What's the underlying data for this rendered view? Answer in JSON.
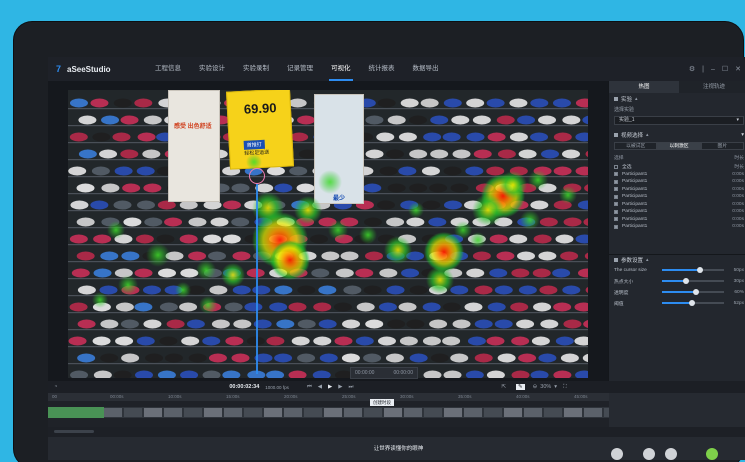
{
  "app": {
    "name": "aSeeStudio"
  },
  "nav": [
    "工程信息",
    "实验设计",
    "实验录制",
    "记录管理",
    "可视化",
    "统计报表",
    "数据导出"
  ],
  "nav_active": "可视化",
  "side": {
    "tabs": [
      "热图",
      "注视轨迹"
    ],
    "experiment_section": "实验",
    "select_label": "选择实验",
    "selected_experiment": "实验_1",
    "data_section": "视频选择",
    "segments": [
      "以被试区",
      "以刺激区",
      "图片"
    ],
    "list_header": [
      "选择",
      "时长"
    ],
    "list_group_title": "全选",
    "participants": [
      {
        "name": "全选",
        "time": "时长",
        "checked": false
      },
      {
        "name": "Participant1",
        "time": "0:00s",
        "checked": true
      },
      {
        "name": "Participant1",
        "time": "0:00s",
        "checked": true
      },
      {
        "name": "Participant1",
        "time": "0:00s",
        "checked": true
      },
      {
        "name": "Participant1",
        "time": "0:00s",
        "checked": true
      },
      {
        "name": "Participant1",
        "time": "0:00s",
        "checked": true
      },
      {
        "name": "Participant1",
        "time": "0:00s",
        "checked": true
      },
      {
        "name": "Participant1",
        "time": "0:00s",
        "checked": true
      },
      {
        "name": "Participant1",
        "time": "0:00s",
        "checked": true
      }
    ],
    "params_section": "参数设置",
    "params": [
      {
        "label": "The cursor size",
        "value": "50px",
        "level": 0.62
      },
      {
        "label": "热点大小",
        "value": "30px",
        "level": 0.38
      },
      {
        "label": "透明度",
        "value": "60%",
        "level": 0.55
      },
      {
        "label": "阈值",
        "value": "52px",
        "level": 0.48
      }
    ]
  },
  "player": {
    "current_time": "00:00:02:34",
    "fps": "1000.00 fps",
    "zoom": "30%",
    "cursor_time_left": "00:00:00",
    "cursor_time_right": "00:00:00"
  },
  "ruler_ticks": [
    "00",
    "00:00s",
    "10:00s",
    "15:00s",
    "20:00s",
    "25:00s",
    "30:00s",
    "35:00s",
    "40:00s",
    "45:00s"
  ],
  "track_label": "创建时段",
  "caption": "让世界读懂你的眼神",
  "scene": {
    "price": "69.90",
    "price_badge": "首推打",
    "price_sub": "轻松足运送",
    "poster_text": "感受 出色舒适",
    "poster2_text": "最少"
  },
  "colors": {
    "accent": "#2d8cf0",
    "backdrop": "#2fb6e4"
  }
}
